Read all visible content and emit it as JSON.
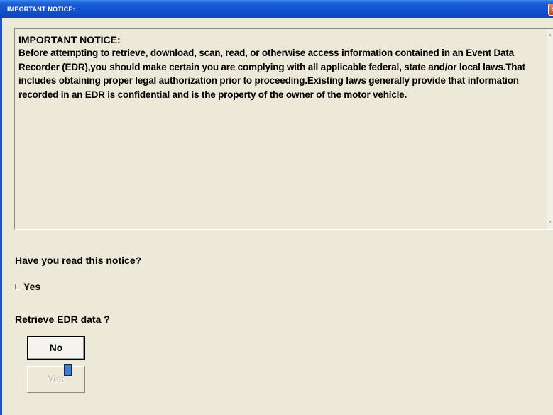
{
  "window": {
    "title": "IMPORTANT NOTICE:",
    "close_glyph": "×"
  },
  "notice": {
    "heading": "IMPORTANT NOTICE:",
    "body": "Before attempting to retrieve, download, scan, read, or otherwise access information contained in an Event Data Recorder (EDR),you should make certain you are complying with all applicable federal, state and/or local laws.That includes obtaining proper legal authorization prior to proceeding.Existing laws generally provide that information recorded in an EDR is confidential and is the property of the owner of the motor vehicle.",
    "scroll_up_glyph": "▲",
    "scroll_down_glyph": "▼"
  },
  "confirm_read": {
    "question": "Have you read this notice?",
    "checkbox_label": "Yes",
    "checked": false
  },
  "retrieve": {
    "question": "Retrieve EDR data ?",
    "no_label": "No",
    "yes_label": "Yes",
    "yes_enabled": false
  },
  "colors": {
    "titlebar": "#1150cf",
    "dialog_bg": "#ece9d8",
    "disabled_text": "#bdbab0"
  },
  "icons": {
    "close": "close-icon",
    "cursor": "mouse-cursor-icon"
  }
}
